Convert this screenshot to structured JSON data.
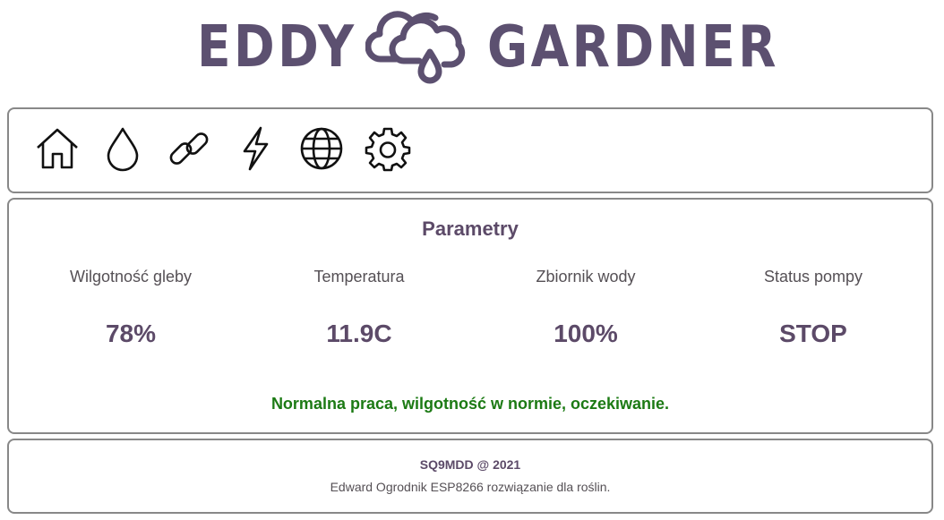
{
  "header": {
    "logo_left": "EDDY",
    "logo_right": "GARDNER",
    "logo_icon": "cloud-droplet-icon",
    "brand_color": "#5c5070"
  },
  "nav": {
    "items": [
      {
        "icon": "home-icon"
      },
      {
        "icon": "droplet-icon"
      },
      {
        "icon": "link-icon"
      },
      {
        "icon": "lightning-icon"
      },
      {
        "icon": "globe-icon"
      },
      {
        "icon": "gear-icon"
      }
    ]
  },
  "parameters": {
    "title": "Parametry",
    "items": [
      {
        "label": "Wilgotność gleby",
        "value": "78%"
      },
      {
        "label": "Temperatura",
        "value": "11.9C"
      },
      {
        "label": "Zbiornik wody",
        "value": "100%"
      },
      {
        "label": "Status pompy",
        "value": "STOP"
      }
    ],
    "status": "Normalna praca, wilgotność w normie, oczekiwanie.",
    "status_color": "#1c7a14"
  },
  "footer": {
    "title": "SQ9MDD @ 2021",
    "subtitle": "Edward Ogrodnik ESP8266 rozwiązanie dla roślin."
  }
}
